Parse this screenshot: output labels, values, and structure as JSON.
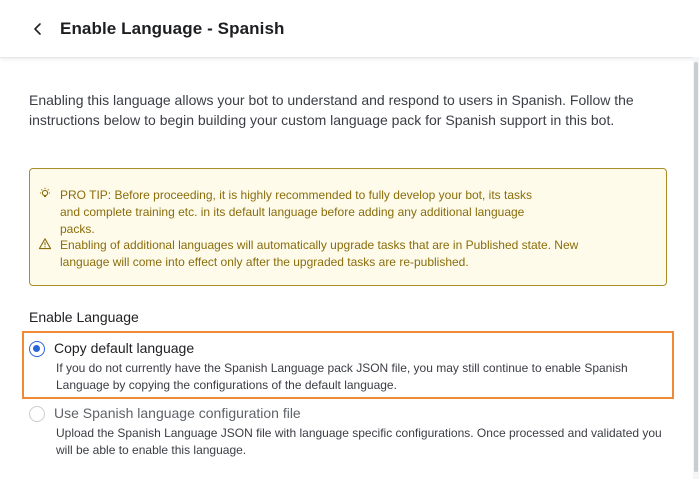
{
  "header": {
    "back_icon": "chevron-left-icon",
    "title": "Enable Language - Spanish"
  },
  "intro": "Enabling this language allows your bot to understand and respond to users in Spanish. Follow the instructions below to begin building your custom language pack for Spanish support in this bot.",
  "tips": {
    "pro_tip_icon": "lightbulb-icon",
    "pro_tip_line1": "PRO TIP: Before proceeding, it is highly recommended to fully develop your bot, its tasks",
    "pro_tip_line2": "and complete training etc. in its default language before adding any additional language",
    "pro_tip_line3": "packs.",
    "warning_icon": "warning-icon",
    "warning_line1": "Enabling of additional languages will automatically upgrade tasks that are in Published state. New",
    "warning_line2": "language will come into effect only after the upgraded tasks are re-published."
  },
  "enable_language": {
    "label": "Enable Language",
    "options": [
      {
        "title": "Copy default language",
        "selected": true,
        "description": "If you do not currently have the Spanish Language pack JSON file, you may still continue to enable Spanish Language by copying the configurations of the default language."
      },
      {
        "title": "Use Spanish language configuration file",
        "selected": false,
        "description": "Upload the Spanish Language JSON file with language specific configurations. Once processed and validated you will be able to enable this language."
      }
    ]
  },
  "colors": {
    "accent": "#2b63d9",
    "highlight_border": "#f08a36",
    "tip_background": "#fefbea",
    "tip_text": "#8a6d0b"
  }
}
